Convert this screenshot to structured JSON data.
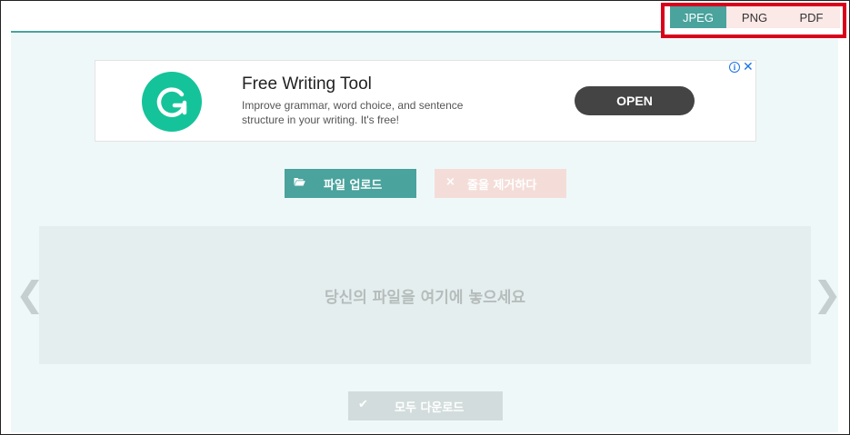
{
  "format_tabs": [
    {
      "label": "JPEG",
      "active": true
    },
    {
      "label": "PNG",
      "active": false
    },
    {
      "label": "PDF",
      "active": false
    }
  ],
  "ad": {
    "title": "Free Writing Tool",
    "description": "Improve grammar, word choice, and sentence structure in your writing. It's free!",
    "open_label": "OPEN",
    "info_icon": "i",
    "close_icon": "✕"
  },
  "actions": {
    "upload_label": "파일 업로드",
    "remove_label": "줄을 제거하다",
    "remove_icon": "×",
    "download_label": "모두 다운로드",
    "download_icon": "✔"
  },
  "dropzone": {
    "text": "당신의 파일을 여기에 놓으세요"
  },
  "nav": {
    "prev": "❮",
    "next": "❯"
  },
  "colors": {
    "accent": "#4aa39d",
    "highlight_border": "#d9001b",
    "tab_inactive": "#fbe9e7",
    "panel_bg": "#eff8f8"
  }
}
